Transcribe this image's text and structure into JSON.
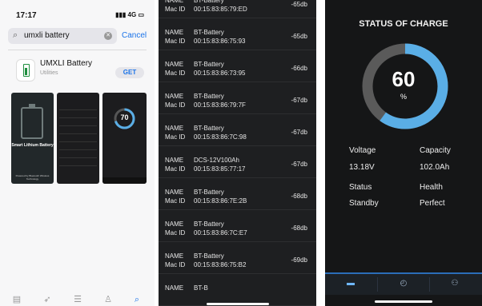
{
  "appstore": {
    "status_time": "17:17",
    "status_network": "4G",
    "search_query": "umxli battery",
    "cancel_label": "Cancel",
    "app_name": "UMXLI Battery",
    "app_category": "Utilities",
    "get_label": "GET",
    "shot1_title": "Smart Lithium Battery",
    "shot1_subtitle": "Powered by Bluetooth Wireless Technology",
    "shot3_value": "70",
    "tabs": [
      {
        "name": "today-tab",
        "icon": "today-icon"
      },
      {
        "name": "games-tab",
        "icon": "rocket-icon"
      },
      {
        "name": "apps-tab",
        "icon": "layers-icon"
      },
      {
        "name": "arcade-tab",
        "icon": "joystick-icon"
      },
      {
        "name": "search-tab",
        "icon": "search-icon",
        "active": true
      }
    ]
  },
  "device_list": {
    "name_label": "NAME",
    "mac_label": "Mac ID",
    "rows": [
      {
        "name": "BT-Battery",
        "mac": "00:15:83:85:79:ED",
        "rssi": "-65db"
      },
      {
        "name": "BT-Battery",
        "mac": "00:15:83:86:75:93",
        "rssi": "-65db"
      },
      {
        "name": "BT-Battery",
        "mac": "00:15:83:86:73:95",
        "rssi": "-66db"
      },
      {
        "name": "BT-Battery",
        "mac": "00:15:83:86:79:7F",
        "rssi": "-67db"
      },
      {
        "name": "BT-Battery",
        "mac": "00:15:83:86:7C:98",
        "rssi": "-67db"
      },
      {
        "name": "DCS-12V100Ah",
        "mac": "00:15:83:85:77:17",
        "rssi": "-67db"
      },
      {
        "name": "BT-Battery",
        "mac": "00:15:83:86:7E:2B",
        "rssi": "-68db"
      },
      {
        "name": "BT-Battery",
        "mac": "00:15:83:86:7C:E7",
        "rssi": "-68db"
      },
      {
        "name": "BT-Battery",
        "mac": "00:15:83:86:75:B2",
        "rssi": "-69db"
      }
    ],
    "partial_row": {
      "name": "BT-B"
    }
  },
  "status": {
    "title": "STATUS OF CHARGE",
    "charge_percent": 60,
    "charge_value": "60",
    "percent_symbol": "%",
    "voltage_label": "Voltage",
    "voltage_value": "13.18V",
    "capacity_label": "Capacity",
    "capacity_value": "102.0Ah",
    "status_label": "Status",
    "status_value": "Standby",
    "health_label": "Health",
    "health_value": "Perfect",
    "accent_color": "#5aaee6",
    "track_color": "#5a5a5a",
    "tabs": [
      {
        "name": "battery-tab",
        "icon": "battery-icon",
        "active": true
      },
      {
        "name": "gauge-tab",
        "icon": "gauge-icon"
      },
      {
        "name": "network-tab",
        "icon": "network-icon"
      }
    ]
  }
}
